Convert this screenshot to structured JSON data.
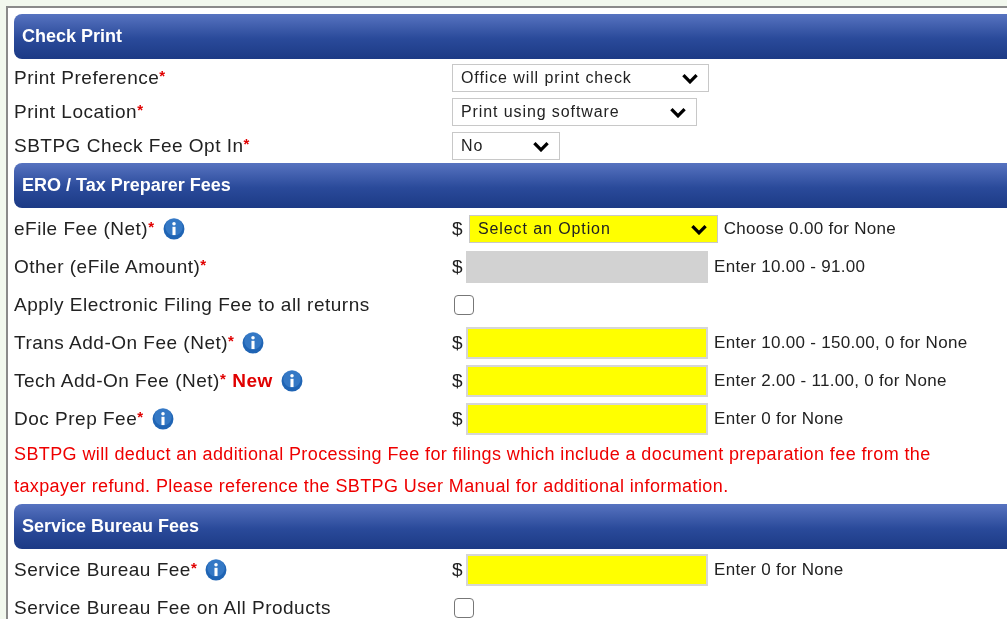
{
  "sections": [
    {
      "title": "Check Print",
      "rows": [
        {
          "kind": "select",
          "label": "Print Preference",
          "required_mark": "*",
          "value": "Office will print check",
          "highlighted": false
        },
        {
          "kind": "select",
          "label": "Print Location",
          "required_mark": "*",
          "value": "Print using software",
          "highlighted": false
        },
        {
          "kind": "select",
          "label": "SBTPG Check Fee Opt In",
          "required_mark": "*",
          "value": "No",
          "highlighted": false
        }
      ]
    },
    {
      "title": "ERO / Tax Preparer Fees",
      "rows": [
        {
          "kind": "select",
          "label": "eFile Fee (Net)",
          "required_mark": "*",
          "info": true,
          "prefix": "$",
          "value": "Select an Option",
          "highlighted": true,
          "hint": "Choose 0.00 for None"
        },
        {
          "kind": "amount",
          "label": "Other (eFile Amount)",
          "required_mark": "*",
          "prefix": "$",
          "disabled": true,
          "hint": "Enter 10.00 - 91.00"
        },
        {
          "kind": "checkbox",
          "label": "Apply Electronic Filing Fee to all returns",
          "checked": false
        },
        {
          "kind": "amount",
          "label": "Trans Add-On Fee (Net)",
          "required_mark": "*",
          "info": true,
          "prefix": "$",
          "disabled": false,
          "hint": "Enter 10.00 - 150.00, 0 for None"
        },
        {
          "kind": "amount",
          "label": "Tech Add-On Fee (Net)",
          "required_mark": "*",
          "badge": "New",
          "info": true,
          "prefix": "$",
          "disabled": false,
          "hint": "Enter 2.00 - 11.00, 0 for None"
        },
        {
          "kind": "amount",
          "label": "Doc Prep Fee",
          "required_mark": "*",
          "info": true,
          "prefix": "$",
          "disabled": false,
          "hint": "Enter 0 for None"
        },
        {
          "kind": "note",
          "text": "SBTPG will deduct an additional Processing Fee for filings which include a document preparation fee from the taxpayer refund. Please reference the SBTPG User Manual for additional information."
        }
      ]
    },
    {
      "title": "Service Bureau Fees",
      "rows": [
        {
          "kind": "amount",
          "label": "Service Bureau Fee",
          "required_mark": "*",
          "info": true,
          "prefix": "$",
          "disabled": false,
          "hint": "Enter 0 for None"
        },
        {
          "kind": "checkbox",
          "label": "Service Bureau Fee on All Products",
          "checked": false
        }
      ]
    }
  ]
}
